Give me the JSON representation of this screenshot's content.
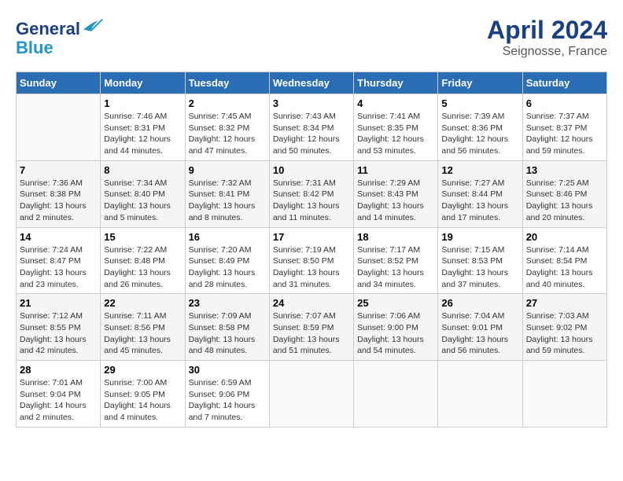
{
  "header": {
    "logo_line1": "General",
    "logo_line2": "Blue",
    "month_year": "April 2024",
    "location": "Seignosse, France"
  },
  "days_of_week": [
    "Sunday",
    "Monday",
    "Tuesday",
    "Wednesday",
    "Thursday",
    "Friday",
    "Saturday"
  ],
  "weeks": [
    [
      {
        "day": "",
        "info": ""
      },
      {
        "day": "1",
        "info": "Sunrise: 7:46 AM\nSunset: 8:31 PM\nDaylight: 12 hours\nand 44 minutes."
      },
      {
        "day": "2",
        "info": "Sunrise: 7:45 AM\nSunset: 8:32 PM\nDaylight: 12 hours\nand 47 minutes."
      },
      {
        "day": "3",
        "info": "Sunrise: 7:43 AM\nSunset: 8:34 PM\nDaylight: 12 hours\nand 50 minutes."
      },
      {
        "day": "4",
        "info": "Sunrise: 7:41 AM\nSunset: 8:35 PM\nDaylight: 12 hours\nand 53 minutes."
      },
      {
        "day": "5",
        "info": "Sunrise: 7:39 AM\nSunset: 8:36 PM\nDaylight: 12 hours\nand 56 minutes."
      },
      {
        "day": "6",
        "info": "Sunrise: 7:37 AM\nSunset: 8:37 PM\nDaylight: 12 hours\nand 59 minutes."
      }
    ],
    [
      {
        "day": "7",
        "info": "Sunrise: 7:36 AM\nSunset: 8:38 PM\nDaylight: 13 hours\nand 2 minutes."
      },
      {
        "day": "8",
        "info": "Sunrise: 7:34 AM\nSunset: 8:40 PM\nDaylight: 13 hours\nand 5 minutes."
      },
      {
        "day": "9",
        "info": "Sunrise: 7:32 AM\nSunset: 8:41 PM\nDaylight: 13 hours\nand 8 minutes."
      },
      {
        "day": "10",
        "info": "Sunrise: 7:31 AM\nSunset: 8:42 PM\nDaylight: 13 hours\nand 11 minutes."
      },
      {
        "day": "11",
        "info": "Sunrise: 7:29 AM\nSunset: 8:43 PM\nDaylight: 13 hours\nand 14 minutes."
      },
      {
        "day": "12",
        "info": "Sunrise: 7:27 AM\nSunset: 8:44 PM\nDaylight: 13 hours\nand 17 minutes."
      },
      {
        "day": "13",
        "info": "Sunrise: 7:25 AM\nSunset: 8:46 PM\nDaylight: 13 hours\nand 20 minutes."
      }
    ],
    [
      {
        "day": "14",
        "info": "Sunrise: 7:24 AM\nSunset: 8:47 PM\nDaylight: 13 hours\nand 23 minutes."
      },
      {
        "day": "15",
        "info": "Sunrise: 7:22 AM\nSunset: 8:48 PM\nDaylight: 13 hours\nand 26 minutes."
      },
      {
        "day": "16",
        "info": "Sunrise: 7:20 AM\nSunset: 8:49 PM\nDaylight: 13 hours\nand 28 minutes."
      },
      {
        "day": "17",
        "info": "Sunrise: 7:19 AM\nSunset: 8:50 PM\nDaylight: 13 hours\nand 31 minutes."
      },
      {
        "day": "18",
        "info": "Sunrise: 7:17 AM\nSunset: 8:52 PM\nDaylight: 13 hours\nand 34 minutes."
      },
      {
        "day": "19",
        "info": "Sunrise: 7:15 AM\nSunset: 8:53 PM\nDaylight: 13 hours\nand 37 minutes."
      },
      {
        "day": "20",
        "info": "Sunrise: 7:14 AM\nSunset: 8:54 PM\nDaylight: 13 hours\nand 40 minutes."
      }
    ],
    [
      {
        "day": "21",
        "info": "Sunrise: 7:12 AM\nSunset: 8:55 PM\nDaylight: 13 hours\nand 42 minutes."
      },
      {
        "day": "22",
        "info": "Sunrise: 7:11 AM\nSunset: 8:56 PM\nDaylight: 13 hours\nand 45 minutes."
      },
      {
        "day": "23",
        "info": "Sunrise: 7:09 AM\nSunset: 8:58 PM\nDaylight: 13 hours\nand 48 minutes."
      },
      {
        "day": "24",
        "info": "Sunrise: 7:07 AM\nSunset: 8:59 PM\nDaylight: 13 hours\nand 51 minutes."
      },
      {
        "day": "25",
        "info": "Sunrise: 7:06 AM\nSunset: 9:00 PM\nDaylight: 13 hours\nand 54 minutes."
      },
      {
        "day": "26",
        "info": "Sunrise: 7:04 AM\nSunset: 9:01 PM\nDaylight: 13 hours\nand 56 minutes."
      },
      {
        "day": "27",
        "info": "Sunrise: 7:03 AM\nSunset: 9:02 PM\nDaylight: 13 hours\nand 59 minutes."
      }
    ],
    [
      {
        "day": "28",
        "info": "Sunrise: 7:01 AM\nSunset: 9:04 PM\nDaylight: 14 hours\nand 2 minutes."
      },
      {
        "day": "29",
        "info": "Sunrise: 7:00 AM\nSunset: 9:05 PM\nDaylight: 14 hours\nand 4 minutes."
      },
      {
        "day": "30",
        "info": "Sunrise: 6:59 AM\nSunset: 9:06 PM\nDaylight: 14 hours\nand 7 minutes."
      },
      {
        "day": "",
        "info": ""
      },
      {
        "day": "",
        "info": ""
      },
      {
        "day": "",
        "info": ""
      },
      {
        "day": "",
        "info": ""
      }
    ]
  ]
}
